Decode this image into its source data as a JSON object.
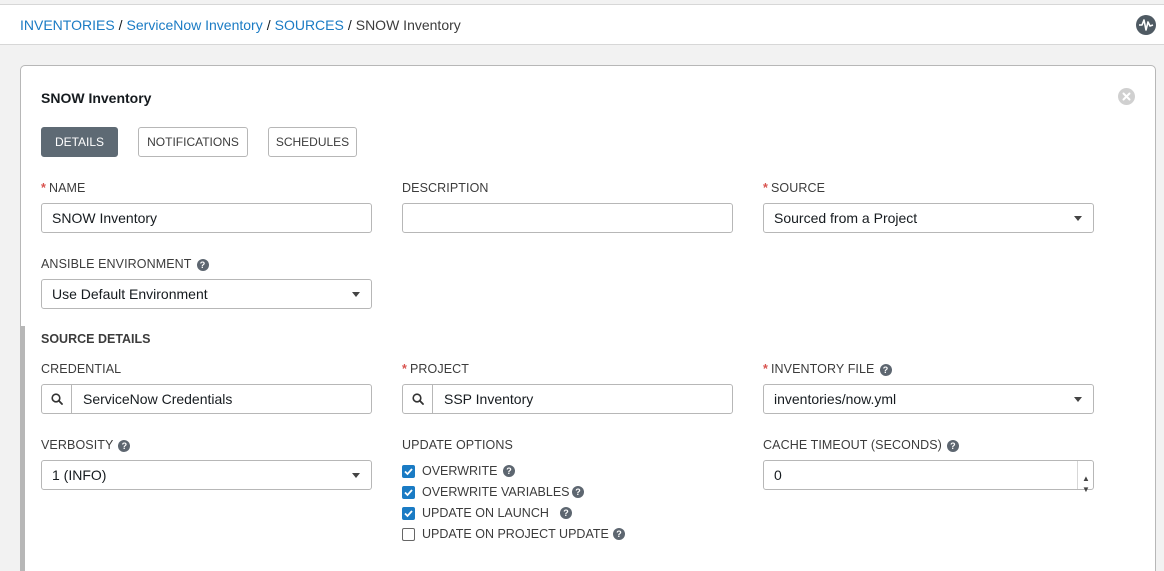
{
  "breadcrumb": {
    "items": [
      "INVENTORIES",
      "ServiceNow Inventory",
      "SOURCES"
    ],
    "current": "SNOW Inventory",
    "separator": "/"
  },
  "form": {
    "title": "SNOW Inventory",
    "tabs": [
      "DETAILS",
      "NOTIFICATIONS",
      "SCHEDULES"
    ],
    "active_tab": "DETAILS",
    "required_mark": "*",
    "name": {
      "label": "NAME",
      "value": "SNOW Inventory"
    },
    "description": {
      "label": "DESCRIPTION",
      "value": ""
    },
    "source": {
      "label": "SOURCE",
      "value": "Sourced from a Project"
    },
    "ansible_environment": {
      "label": "ANSIBLE ENVIRONMENT",
      "value": "Use Default Environment"
    },
    "source_details": {
      "title": "SOURCE DETAILS",
      "credential": {
        "label": "CREDENTIAL",
        "value": "ServiceNow Credentials"
      },
      "project": {
        "label": "PROJECT",
        "value": "SSP Inventory"
      },
      "inventory_file": {
        "label": "INVENTORY FILE",
        "value": "inventories/now.yml"
      },
      "verbosity": {
        "label": "VERBOSITY",
        "value": "1 (INFO)"
      },
      "update_options": {
        "label": "UPDATE OPTIONS",
        "options": [
          {
            "label": "OVERWRITE",
            "checked": true
          },
          {
            "label": "OVERWRITE VARIABLES",
            "checked": true
          },
          {
            "label": "UPDATE ON LAUNCH",
            "checked": true
          },
          {
            "label": "UPDATE ON PROJECT UPDATE",
            "checked": false
          }
        ]
      },
      "cache_timeout": {
        "label": "CACHE TIMEOUT (SECONDS)",
        "value": "0"
      }
    }
  },
  "icons": {
    "help": "?",
    "activity": "activity-stream-icon",
    "close": "close-icon",
    "search": "search-icon"
  },
  "colors": {
    "link": "#1a7bc4",
    "active_tab": "#5e6a74",
    "required": "#d9534f",
    "checkbox": "#1a7bc4"
  }
}
